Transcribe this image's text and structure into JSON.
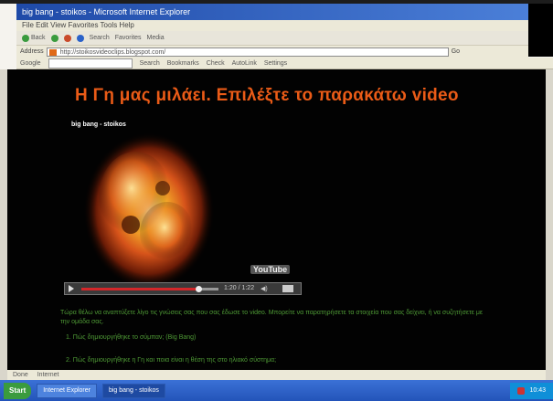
{
  "browser": {
    "window_title": "big bang - stoikos - Microsoft Internet Explorer",
    "menu": "File   Edit   View   Favorites   Tools   Help",
    "toolbar": {
      "back": "Back",
      "search": "Search",
      "favorites": "Favorites",
      "media": "Media"
    },
    "address": {
      "label": "Address",
      "value": "http://stoikosvideoclips.blogspot.com/",
      "go": "Go"
    },
    "google_bar": {
      "label": "Google",
      "items": [
        "Search",
        "Bookmarks",
        "Check",
        "AutoLink",
        "Settings"
      ]
    },
    "status_items": [
      "Done",
      "Internet"
    ]
  },
  "page": {
    "title": "Η Γη μας μιλάει. Επιλέξτε το παρακάτω video",
    "video_caption": "big bang - stoikos",
    "youtube_label": "YouTube",
    "player": {
      "progress": 0.85,
      "time": "1:20 / 1:22"
    },
    "description": "Τώρα θέλω να αναπτύξετε λίγο τις γνώσεις σας που σας έδωσε το video. Μπορείτε να παρατηρήσετε τα στοιχεία που σας δείχνει, ή να συζητήσετε με την ομάδα σας.",
    "items": [
      "1. Πώς δημιουργήθηκε το σύμπαν; (Big Bang)",
      "2. Πώς δημιουργήθηκε η Γη και ποια είναι η θέση της στο ηλιακό σύστημα;"
    ]
  },
  "taskbar": {
    "start": "Start",
    "tasks": [
      "Internet Explorer",
      "big bang - stoikos"
    ],
    "clock": "10:43"
  }
}
